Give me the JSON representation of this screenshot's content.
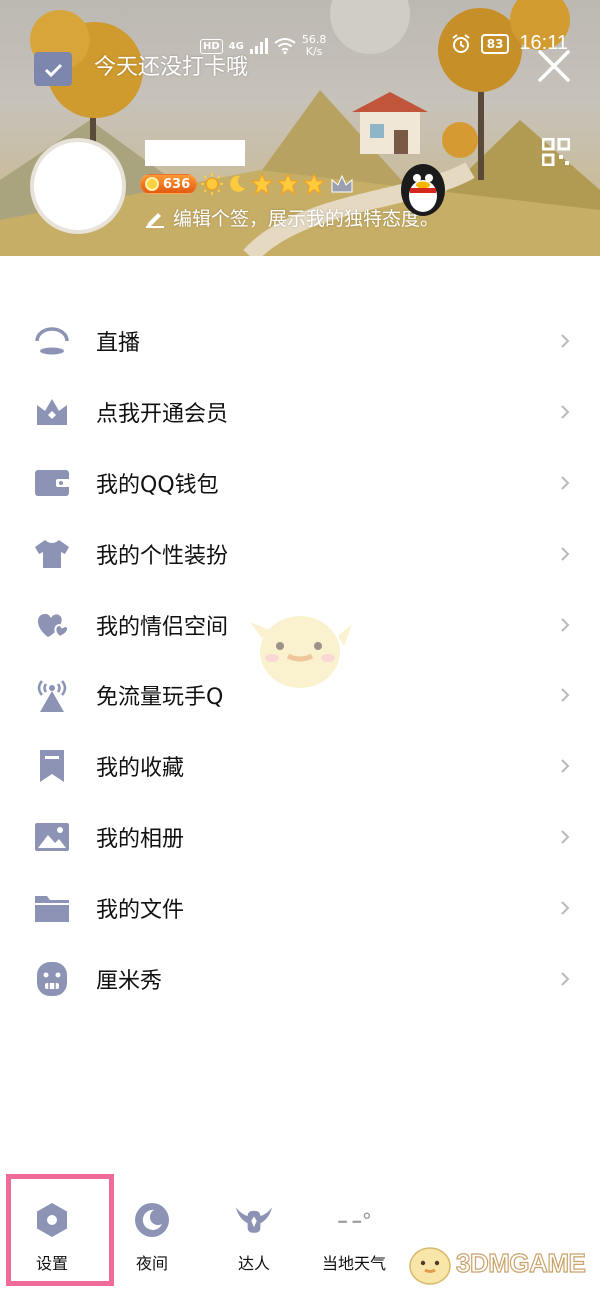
{
  "status_bar": {
    "hd": "HD",
    "network": "4G",
    "speed_value": "56.8",
    "speed_unit": "K/s",
    "battery": "83",
    "time": "16:11"
  },
  "header": {
    "checkin_text": "今天还没打卡哦",
    "level_value": "636",
    "signature": "编辑个签，展示我的独特态度。"
  },
  "menu": {
    "items": [
      {
        "label": "直播",
        "icon": "live-icon"
      },
      {
        "label": "点我开通会员",
        "icon": "vip-crown-icon"
      },
      {
        "label": "我的QQ钱包",
        "icon": "wallet-icon"
      },
      {
        "label": "我的个性装扮",
        "icon": "tshirt-icon"
      },
      {
        "label": "我的情侣空间",
        "icon": "hearts-icon"
      },
      {
        "label": "免流量玩手Q",
        "icon": "broadcast-icon"
      },
      {
        "label": "我的收藏",
        "icon": "bookmark-icon"
      },
      {
        "label": "我的相册",
        "icon": "photo-icon"
      },
      {
        "label": "我的文件",
        "icon": "folder-icon"
      },
      {
        "label": "厘米秀",
        "icon": "cmshow-face-icon"
      }
    ]
  },
  "bottom_bar": {
    "settings": "设置",
    "night": "夜间",
    "expert": "达人",
    "weather": "当地天气"
  },
  "watermark": "3DMGAME",
  "colors": {
    "icon": "#8d93b4",
    "highlight": "#f06a9a",
    "level_badge": "#e8681a"
  }
}
